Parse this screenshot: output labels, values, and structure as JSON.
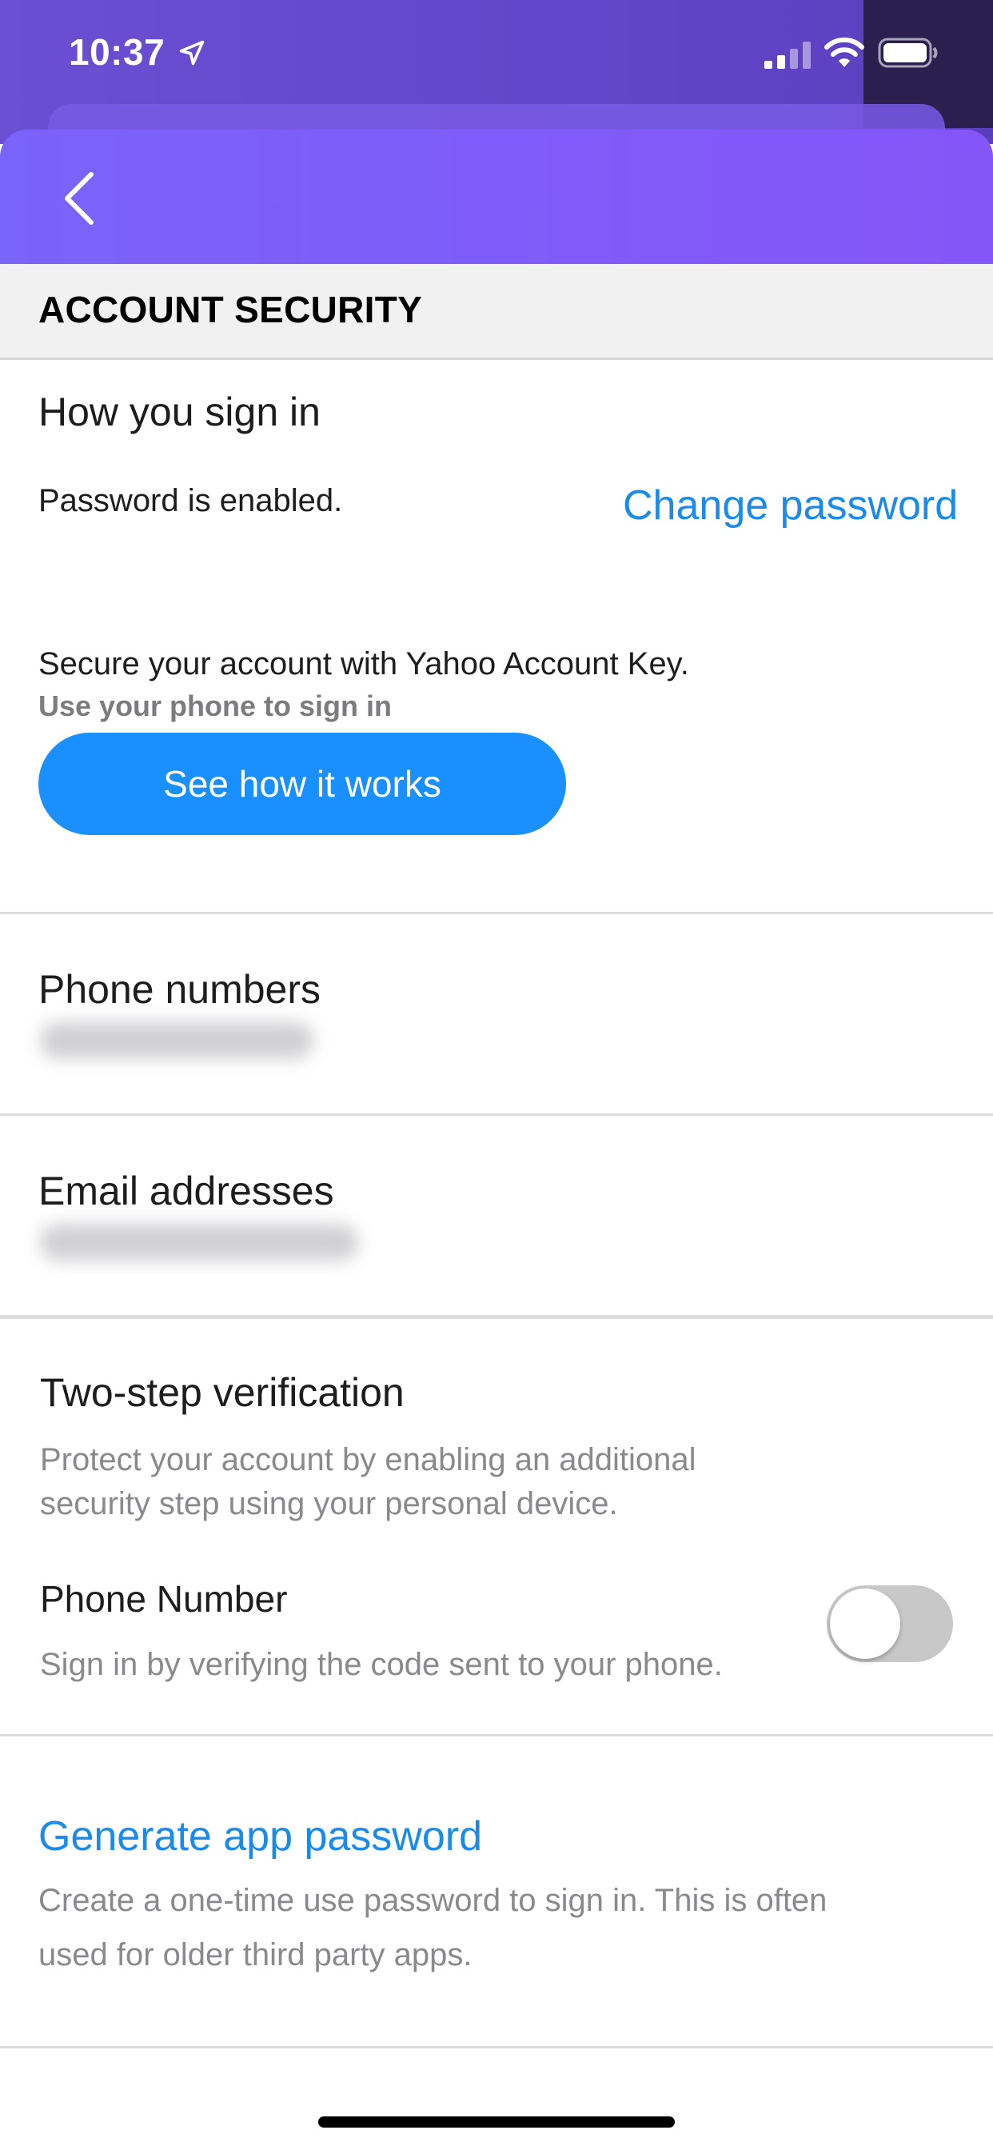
{
  "status_bar": {
    "time": "10:37"
  },
  "section": {
    "title": "ACCOUNT SECURITY"
  },
  "sign_in": {
    "title": "How you sign in",
    "password_status": "Password is enabled.",
    "change_password_link": "Change password",
    "account_key_text": "Secure your account with Yahoo Account Key.",
    "account_key_sub": "Use your phone to sign in",
    "see_how_button": "See how it works"
  },
  "phone_numbers": {
    "title": "Phone numbers"
  },
  "email_addresses": {
    "title": "Email addresses"
  },
  "two_step": {
    "title": "Two-step verification",
    "desc_line1": "Protect your account by enabling an additional",
    "desc_line2": "security step using your personal device.",
    "phone_number_label": "Phone Number",
    "phone_number_desc": "Sign in by verifying the code sent to your phone.",
    "phone_toggle_on": false
  },
  "app_password": {
    "link": "Generate app password",
    "desc_line1": "Create a one-time use password to sign in. This is often",
    "desc_line2": "used for older third party apps."
  },
  "colors": {
    "header_purple": "#7f5cf9",
    "link_blue": "#1a8bea",
    "button_blue": "#1a90ff"
  },
  "icons": [
    "location-arrow-icon",
    "cellular-signal-icon",
    "wifi-icon",
    "battery-icon",
    "chevron-left-icon"
  ]
}
